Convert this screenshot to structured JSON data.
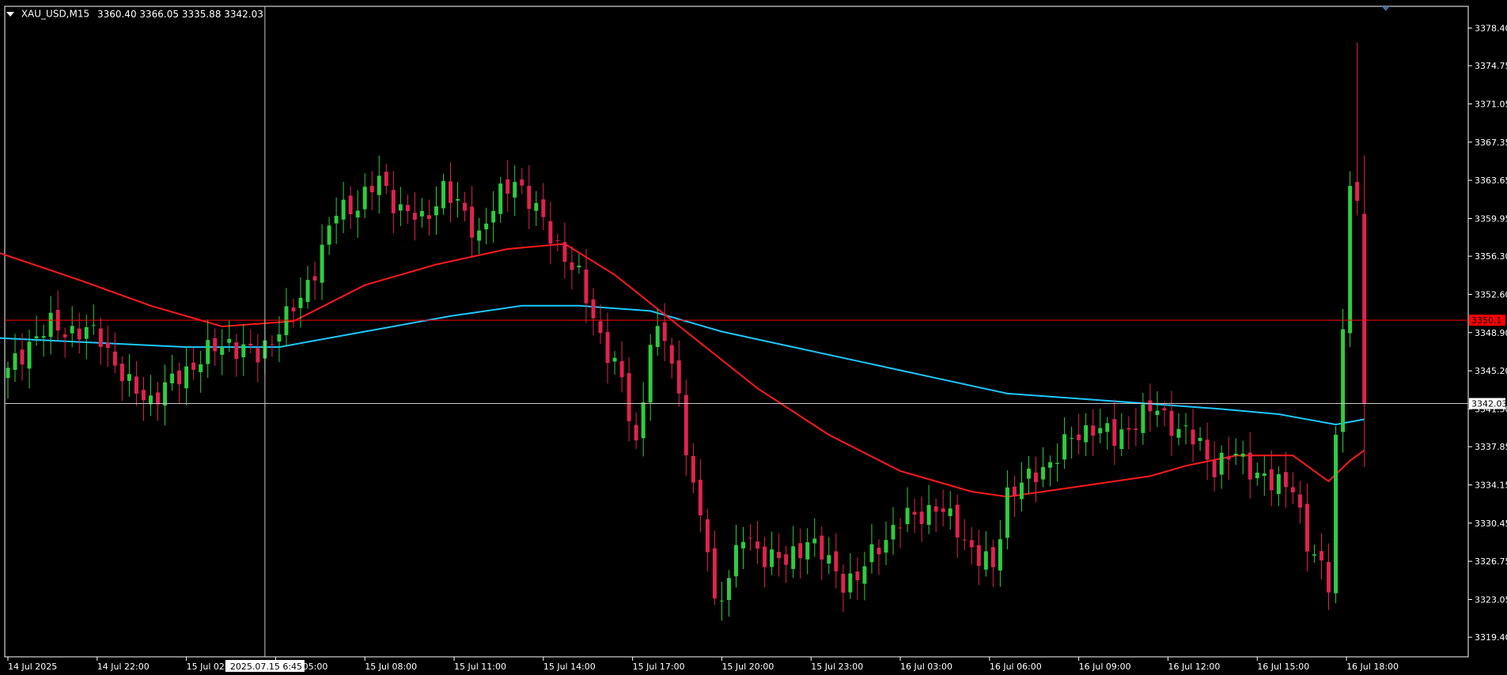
{
  "header": {
    "symbol": "XAU_USD,M15",
    "ohlc": "3360.40 3366.05 3335.88 3342.03"
  },
  "crosshair": {
    "time_label": "2025.07.15 6:45",
    "price_label": "3342.03"
  },
  "current_price_label": "3350.1",
  "colors": {
    "background": "#000000",
    "grid_frame": "#ffffff",
    "bull": "#2ecc40",
    "bear": "#e0234e",
    "ma_fast": "#ff1a1a",
    "ma_slow": "#1ec8ff",
    "price_line": "#ff0000",
    "crosshair": "#c8c8c8"
  },
  "chart_data": {
    "type": "candlestick",
    "ylim": [
      3317.5,
      3380.5
    ],
    "y_ticks": [
      3378.4,
      3374.75,
      3371.05,
      3367.35,
      3363.65,
      3359.95,
      3356.3,
      3352.6,
      3348.9,
      3345.2,
      3341.5,
      3337.85,
      3334.15,
      3330.45,
      3326.75,
      3323.05,
      3319.4
    ],
    "x_labels": [
      "14 Jul 2025",
      "14 Jul 22:00",
      "15 Jul 02:00",
      "15 Jul 05:00",
      "15 Jul 08:00",
      "15 Jul 11:00",
      "15 Jul 14:00",
      "15 Jul 17:00",
      "15 Jul 20:00",
      "15 Jul 23:00",
      "16 Jul 03:00",
      "16 Jul 06:00",
      "16 Jul 09:00",
      "16 Jul 12:00",
      "16 Jul 15:00",
      "16 Jul 18:00"
    ],
    "x_label_positions": [
      0.0,
      12.5,
      25.0,
      37.5,
      50.0,
      62.5,
      75.0,
      87.5,
      100.0,
      112.5,
      125.0,
      137.5,
      150.0,
      162.5,
      175.0,
      187.5
    ],
    "crosshair_index": 36,
    "current_price": 3350.1,
    "crosshair_price": 3342.03,
    "keypoints": [
      [
        0,
        3345.0
      ],
      [
        3,
        3348.0
      ],
      [
        6,
        3349.5
      ],
      [
        10,
        3349.0
      ],
      [
        13,
        3348.5
      ],
      [
        17,
        3343.5
      ],
      [
        20,
        3342.5
      ],
      [
        23,
        3344.0
      ],
      [
        27,
        3346.5
      ],
      [
        31,
        3348.0
      ],
      [
        35,
        3346.5
      ],
      [
        38,
        3349.5
      ],
      [
        41,
        3352.0
      ],
      [
        44,
        3357.0
      ],
      [
        46,
        3360.5
      ],
      [
        49,
        3361.5
      ],
      [
        52,
        3363.5
      ],
      [
        55,
        3361.0
      ],
      [
        58,
        3359.5
      ],
      [
        61,
        3363.0
      ],
      [
        63,
        3361.0
      ],
      [
        66,
        3358.5
      ],
      [
        69,
        3362.0
      ],
      [
        71,
        3364.0
      ],
      [
        74,
        3360.5
      ],
      [
        77,
        3357.5
      ],
      [
        80,
        3354.0
      ],
      [
        82,
        3350.5
      ],
      [
        84,
        3347.0
      ],
      [
        86,
        3344.0
      ],
      [
        88,
        3338.0
      ],
      [
        90,
        3348.0
      ],
      [
        92,
        3348.5
      ],
      [
        94,
        3343.0
      ],
      [
        96,
        3333.5
      ],
      [
        98,
        3328.0
      ],
      [
        99,
        3322.5
      ],
      [
        101,
        3325.5
      ],
      [
        103,
        3329.0
      ],
      [
        106,
        3327.5
      ],
      [
        109,
        3326.5
      ],
      [
        112,
        3329.0
      ],
      [
        115,
        3326.5
      ],
      [
        117,
        3325.0
      ],
      [
        119,
        3325.0
      ],
      [
        122,
        3328.5
      ],
      [
        125,
        3330.5
      ],
      [
        128,
        3331.5
      ],
      [
        130,
        3332.0
      ],
      [
        133,
        3330.0
      ],
      [
        136,
        3327.0
      ],
      [
        138,
        3326.0
      ],
      [
        140,
        3333.5
      ],
      [
        143,
        3334.5
      ],
      [
        146,
        3336.5
      ],
      [
        149,
        3338.5
      ],
      [
        152,
        3340.0
      ],
      [
        155,
        3338.5
      ],
      [
        158,
        3340.5
      ],
      [
        161,
        3341.5
      ],
      [
        164,
        3339.5
      ],
      [
        167,
        3338.0
      ],
      [
        169,
        3336.0
      ],
      [
        172,
        3337.0
      ],
      [
        174,
        3336.0
      ],
      [
        177,
        3334.0
      ],
      [
        180,
        3334.5
      ],
      [
        182,
        3328.0
      ],
      [
        184,
        3326.0
      ],
      [
        185,
        3325.0
      ],
      [
        186,
        3339.0
      ],
      [
        187,
        3349.0
      ],
      [
        188,
        3363.5
      ],
      [
        189,
        3360.4
      ],
      [
        190,
        3342.03
      ]
    ],
    "ma_fast": [
      [
        -5,
        3357.5
      ],
      [
        10,
        3354.0
      ],
      [
        20,
        3351.5
      ],
      [
        30,
        3349.5
      ],
      [
        40,
        3350.0
      ],
      [
        50,
        3353.5
      ],
      [
        60,
        3355.5
      ],
      [
        70,
        3357.0
      ],
      [
        78,
        3357.5
      ],
      [
        85,
        3354.5
      ],
      [
        95,
        3349.0
      ],
      [
        105,
        3343.5
      ],
      [
        115,
        3339.0
      ],
      [
        125,
        3335.5
      ],
      [
        135,
        3333.5
      ],
      [
        140,
        3333.0
      ],
      [
        150,
        3334.0
      ],
      [
        160,
        3335.0
      ],
      [
        165,
        3336.0
      ],
      [
        172,
        3337.0
      ],
      [
        180,
        3337.0
      ],
      [
        185,
        3334.5
      ],
      [
        188,
        3336.5
      ],
      [
        190,
        3337.5
      ]
    ],
    "ma_slow": [
      [
        -5,
        3348.5
      ],
      [
        10,
        3348.0
      ],
      [
        25,
        3347.5
      ],
      [
        38,
        3347.5
      ],
      [
        50,
        3349.0
      ],
      [
        62,
        3350.5
      ],
      [
        72,
        3351.5
      ],
      [
        80,
        3351.5
      ],
      [
        90,
        3351.0
      ],
      [
        100,
        3349.0
      ],
      [
        110,
        3347.5
      ],
      [
        120,
        3346.0
      ],
      [
        130,
        3344.5
      ],
      [
        140,
        3343.0
      ],
      [
        150,
        3342.5
      ],
      [
        160,
        3342.0
      ],
      [
        170,
        3341.5
      ],
      [
        178,
        3341.0
      ],
      [
        186,
        3340.0
      ],
      [
        190,
        3340.5
      ]
    ]
  }
}
